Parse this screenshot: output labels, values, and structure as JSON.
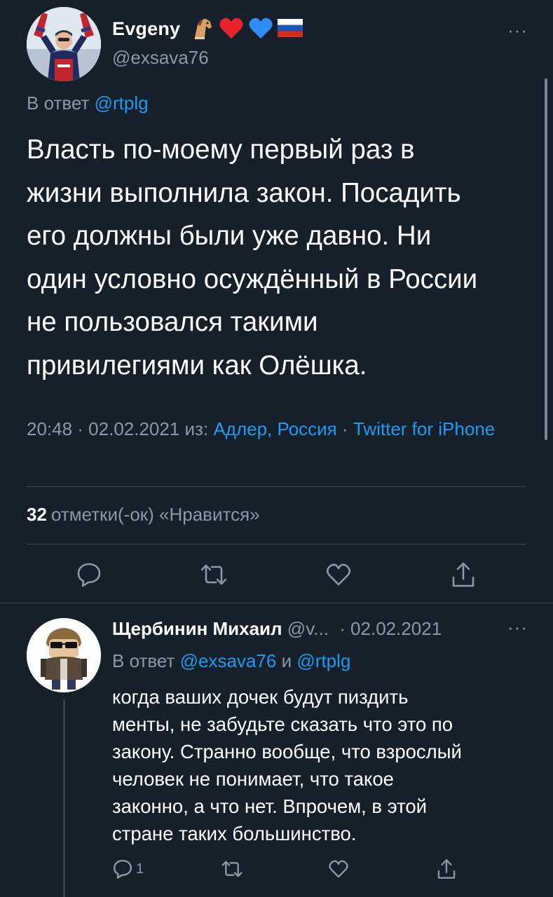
{
  "main_tweet": {
    "author_name": "Evgeny",
    "author_emoji": [
      "horse-emoji",
      "red-heart-emoji",
      "blue-heart-emoji",
      "russia-flag-emoji"
    ],
    "author_handle": "@exsava76",
    "more_label": "···",
    "reply_prefix": "В ответ",
    "reply_mention": "@rtplg",
    "text": "Власть по-моему первый раз в\nжизни выполнила закон. Посадить\nего должны были уже давно. Ни\nодин условно осуждённый в России\nне пользовался такими\nпривилегиями как Олёшка.",
    "timestamp": "20:48 · 02.02.2021",
    "from_label": "из:",
    "location": "Адлер, Россия",
    "separator": "·",
    "source": "Twitter for iPhone",
    "likes_count": "32",
    "likes_label": "отметки(-ок) «Нравится»"
  },
  "reply_tweet": {
    "author_name": "Щербинин Михаил",
    "author_handle": "@v...",
    "date": "· 02.02.2021",
    "more_label": "···",
    "reply_prefix": "В ответ",
    "mention_1": "@exsava76",
    "conjunction": "и",
    "mention_2": "@rtplg",
    "text": "когда ваших дочек будут пиздить\nменты, не забудьте сказать что это по\nзакону. Странно вообще, что взрослый\nчеловек не понимает, что такое\nзаконно, а что нет. Впрочем, в этой\nстране таких большинство.",
    "reply_count": "1"
  },
  "colors": {
    "background": "#15202b",
    "text_primary": "#ffffff",
    "text_secondary": "#8b98a5",
    "link": "#1d9bf0",
    "divider": "#38444d"
  }
}
